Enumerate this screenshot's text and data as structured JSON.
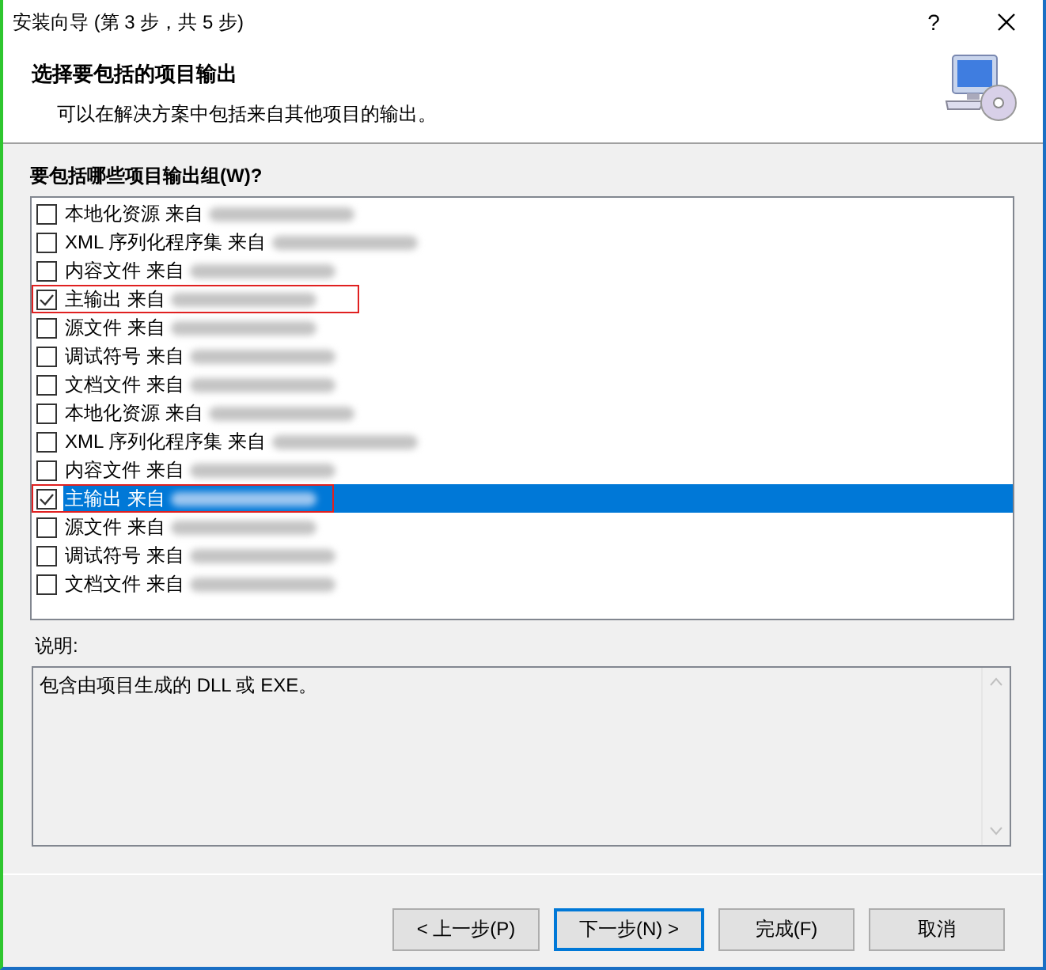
{
  "window": {
    "title": "安装向导 (第 3 步，共 5 步)",
    "help": "?"
  },
  "header": {
    "title": "选择要包括的项目输出",
    "subtitle": "可以在解决方案中包括来自其他项目的输出。"
  },
  "groups_label": "要包括哪些项目输出组(W)?",
  "groups": [
    {
      "label": "本地化资源 来自",
      "checked": false,
      "selected": false,
      "highlighted": false
    },
    {
      "label": "XML 序列化程序集 来自",
      "checked": false,
      "selected": false,
      "highlighted": false
    },
    {
      "label": "内容文件 来自",
      "checked": false,
      "selected": false,
      "highlighted": false
    },
    {
      "label": "主输出 来自",
      "checked": true,
      "selected": false,
      "highlighted": true
    },
    {
      "label": "源文件 来自",
      "checked": false,
      "selected": false,
      "highlighted": false
    },
    {
      "label": "调试符号 来自",
      "checked": false,
      "selected": false,
      "highlighted": false
    },
    {
      "label": "文档文件 来自",
      "checked": false,
      "selected": false,
      "highlighted": false
    },
    {
      "label": "本地化资源 来自",
      "checked": false,
      "selected": false,
      "highlighted": false
    },
    {
      "label": "XML 序列化程序集 来自",
      "checked": false,
      "selected": false,
      "highlighted": false
    },
    {
      "label": "内容文件 来自",
      "checked": false,
      "selected": false,
      "highlighted": false
    },
    {
      "label": "主输出 来自",
      "checked": true,
      "selected": true,
      "highlighted": true
    },
    {
      "label": "源文件 来自",
      "checked": false,
      "selected": false,
      "highlighted": false
    },
    {
      "label": "调试符号 来自",
      "checked": false,
      "selected": false,
      "highlighted": false
    },
    {
      "label": "文档文件 来自",
      "checked": false,
      "selected": false,
      "highlighted": false
    }
  ],
  "description": {
    "label": "说明:",
    "text": "包含由项目生成的 DLL 或 EXE。"
  },
  "buttons": [
    {
      "label": "< 上一步(P)",
      "default": false
    },
    {
      "label": "下一步(N) >",
      "default": true
    },
    {
      "label": "完成(F)",
      "default": false
    },
    {
      "label": "取消",
      "default": false
    }
  ]
}
